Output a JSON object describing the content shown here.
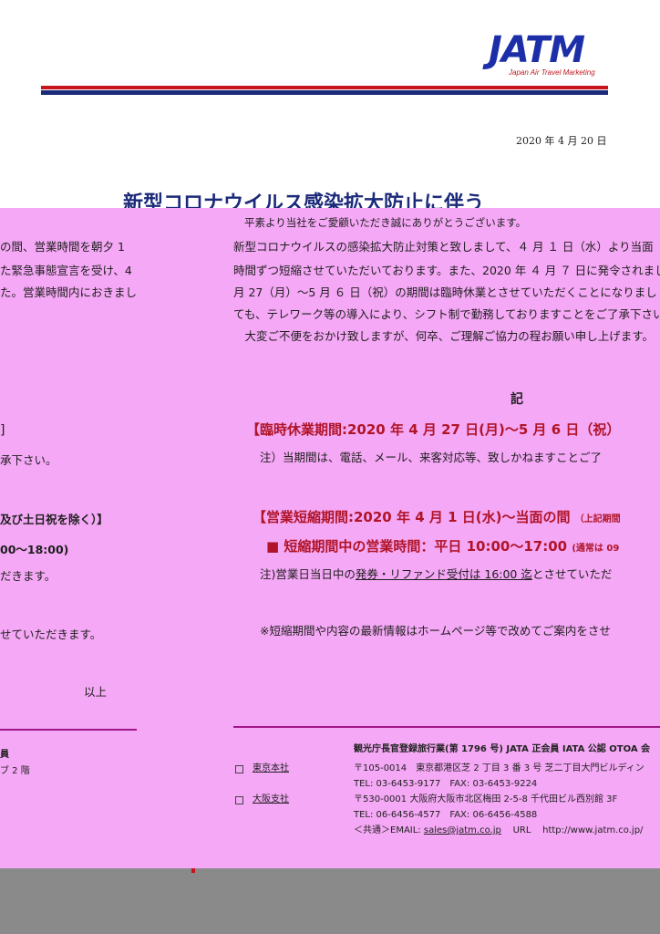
{
  "header": {
    "logo_text": "JATM",
    "logo_subtext": "Japan Air Travel Marketing",
    "date": "2020 年 4 月 20 日",
    "title": "新型コロナウイルス感染拡大防止に伴う"
  },
  "left_panel": {
    "lines": [
      "の間、営業時間を朝夕 1",
      "た緊急事態宣言を受け、4",
      "た。営業時間内におきまし",
      "]",
      "承下さい。",
      "及び土日祝を除く）】",
      "00～18:00)",
      "だきます。",
      "せていただきます。",
      "以上",
      "員",
      "ブ 2 階"
    ]
  },
  "right_panel": {
    "top_line": "平素より当社をご愛顧いただき誠にありがとうございます。",
    "intro": [
      "新型コロナウイルスの感染拡大防止対策と致しまして、４ 月 １ 日（水）より当面",
      "時間ずつ短縮させていただいております。また、2020 年 ４ 月 ７ 日に発令されまし",
      "月 27（月）～5 月 ６ 日（祝）の期間は臨時休業とさせていただくことになりまし",
      "ても、テレワーク等の導入により、シフト制で勤務しておりますことをご了承下さい。",
      "　大変ご不便をおかけ致しますが、何卒、ご理解ご協力の程お願い申し上げます。"
    ],
    "ki": "記",
    "closure_heading": "【臨時休業期間:2020 年 4 月 27 日(月)～5 月 6 日（祝）",
    "closure_note": "注）当期間は、電話、メール、来客対応等、致しかねますことご了",
    "short_heading": "【営業短縮期間:2020 年 4 月 1 日(水)～当面の間",
    "short_heading_small": "（上記期間",
    "hours_label": "■ 短縮期間中の営業時間：平日 10:00～17:00",
    "hours_small": "(通常は 09",
    "hours_note_prefix": "注)営業日当日中の",
    "hours_note_underlined": "発券・リファンド受付は 16:00 迄",
    "hours_note_suffix": "とさせていただ",
    "latest_note": "※短縮期間や内容の最新情報はホームページ等で改めてご案内をさせ"
  },
  "footer": {
    "registration": "観光庁長官登録旅行業(第 1796 号) JATA 正会員  IATA 公認  OTOA 会",
    "offices": [
      {
        "name": "東京本社",
        "address": "〒105-0014　東京都港区芝 2 丁目 3 番 3 号  芝二丁目大門ビルディン",
        "tel": "TEL: 03-6453-9177　FAX: 03-6453-9224"
      },
      {
        "name": "大阪支社",
        "address": "〒530-0001  大阪府大阪市北区梅田 2-5-8  千代田ビル西別館 3F",
        "tel": "TEL: 06-6456-4577　FAX: 06-6456-4588"
      }
    ],
    "common_prefix": "＜共通＞EMAIL: ",
    "email": "sales@jatm.co.jp",
    "url_label": "URL",
    "url": "http://www.jatm.co.jp/"
  },
  "colors": {
    "overlay_pink": "#f5a8f5",
    "brand_navy": "#1b2a7a",
    "brand_red": "#c8141c",
    "heading_red": "#b01428",
    "divider_purple": "#a0158a",
    "bottom_gray": "#8a8a8a"
  }
}
